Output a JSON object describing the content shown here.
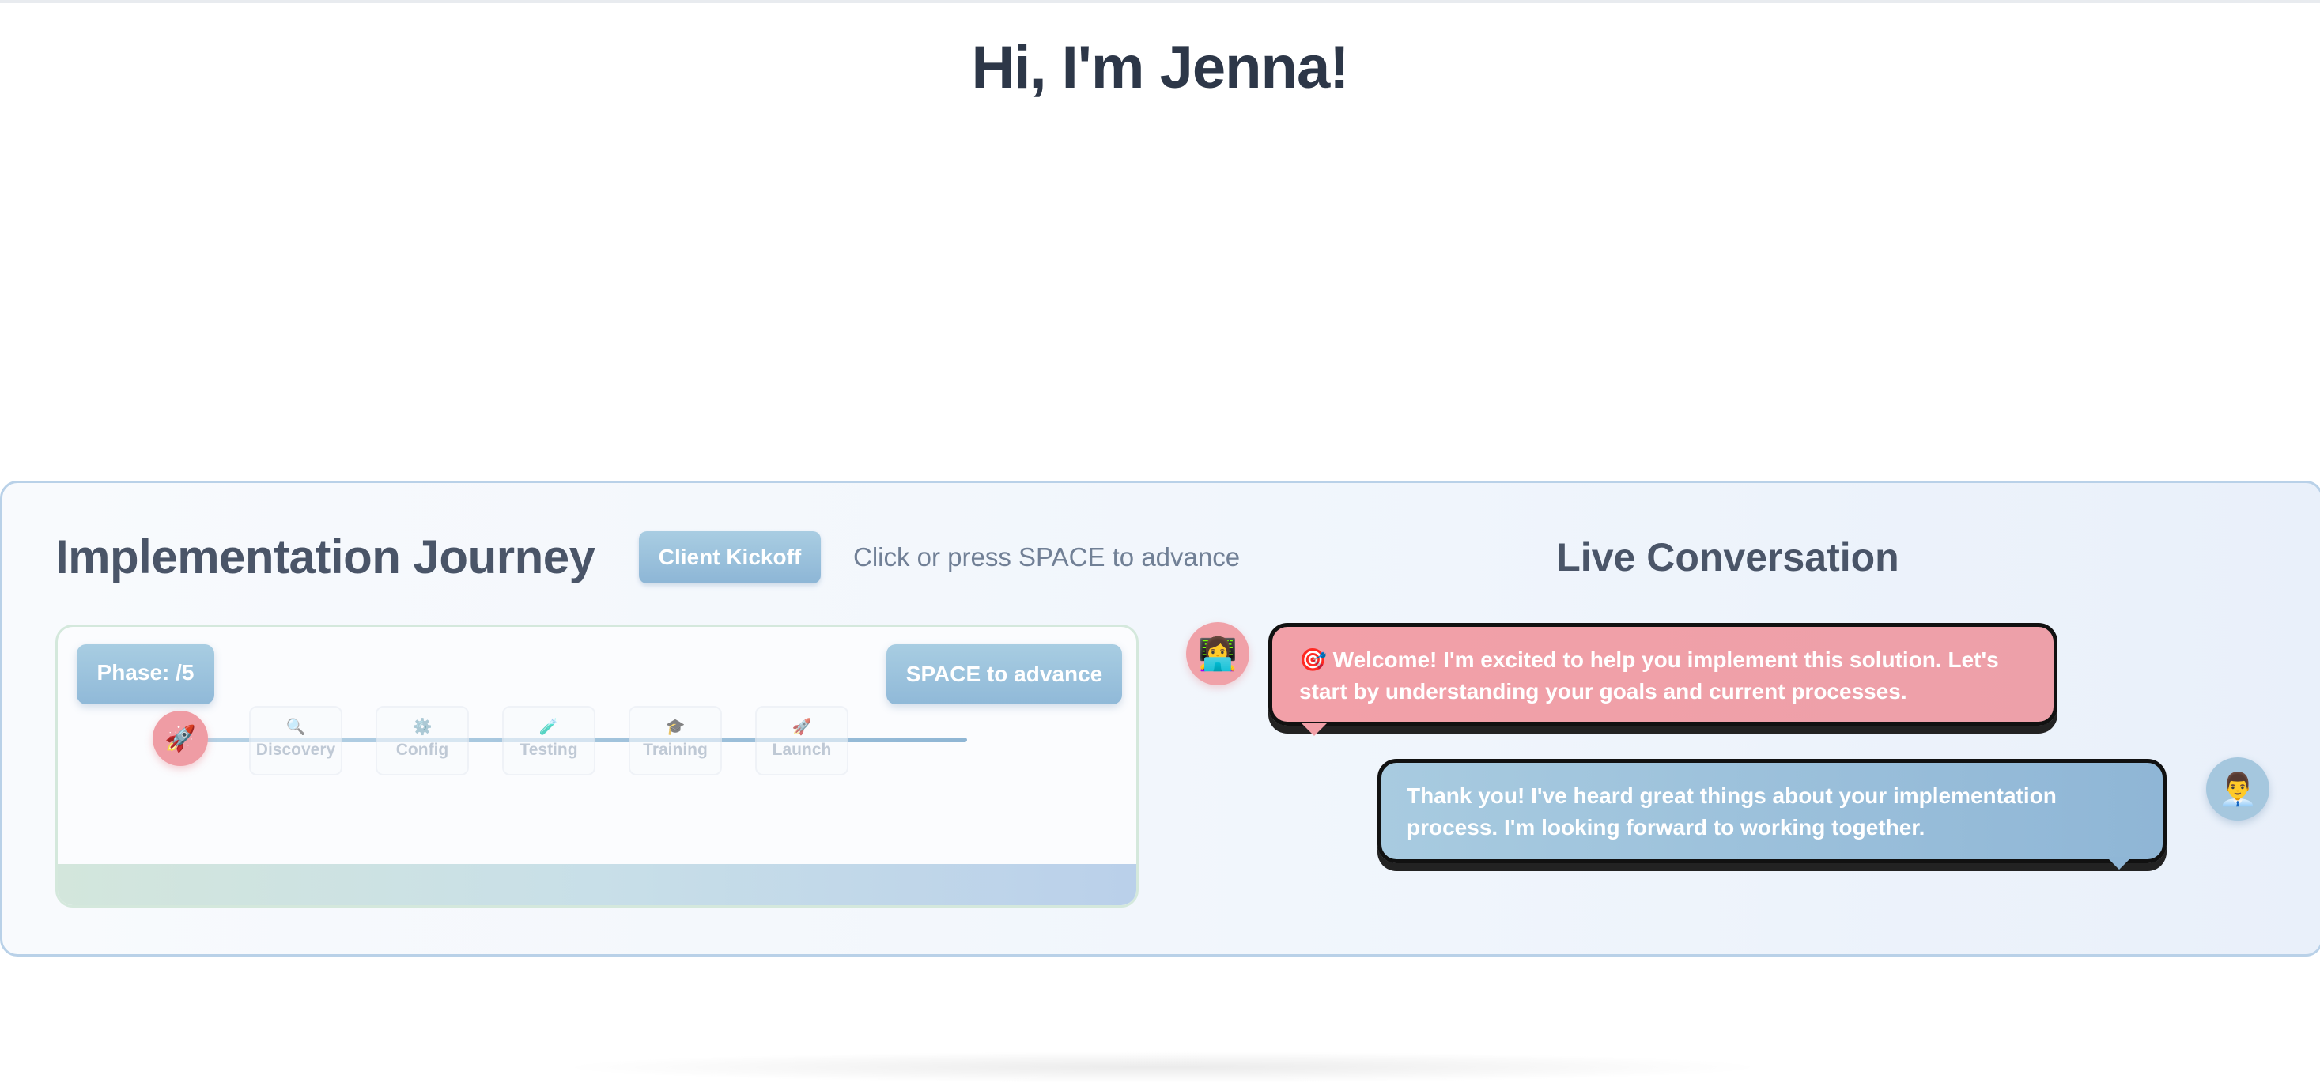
{
  "hero": {
    "title": "Hi, I'm Jenna!"
  },
  "journey": {
    "title": "Implementation Journey",
    "stage_button": "Client Kickoff",
    "hint": "Click or press SPACE to advance",
    "phase_label": "Phase: /5",
    "space_button": "SPACE to advance",
    "rocket_icon": "🚀",
    "steps": [
      {
        "icon": "🔍",
        "label": "Discovery"
      },
      {
        "icon": "⚙️",
        "label": "Config"
      },
      {
        "icon": "🧪",
        "label": "Testing"
      },
      {
        "icon": "🎓",
        "label": "Training"
      },
      {
        "icon": "🚀",
        "label": "Launch"
      }
    ]
  },
  "conversation": {
    "title": "Live Conversation",
    "jenna_avatar": "👩‍💻",
    "client_avatar": "👨‍💼",
    "messages": [
      {
        "from": "jenna",
        "text": "🎯 Welcome! I'm excited to help you implement this solution. Let's start by understanding your goals and current processes."
      },
      {
        "from": "client",
        "text": "Thank you! I've heard great things about your implementation process. I'm looking forward to working together."
      }
    ]
  },
  "colors": {
    "jenna_accent": "#f2a0a8",
    "client_accent": "#8fb6d6",
    "title_text": "#2d3748"
  }
}
